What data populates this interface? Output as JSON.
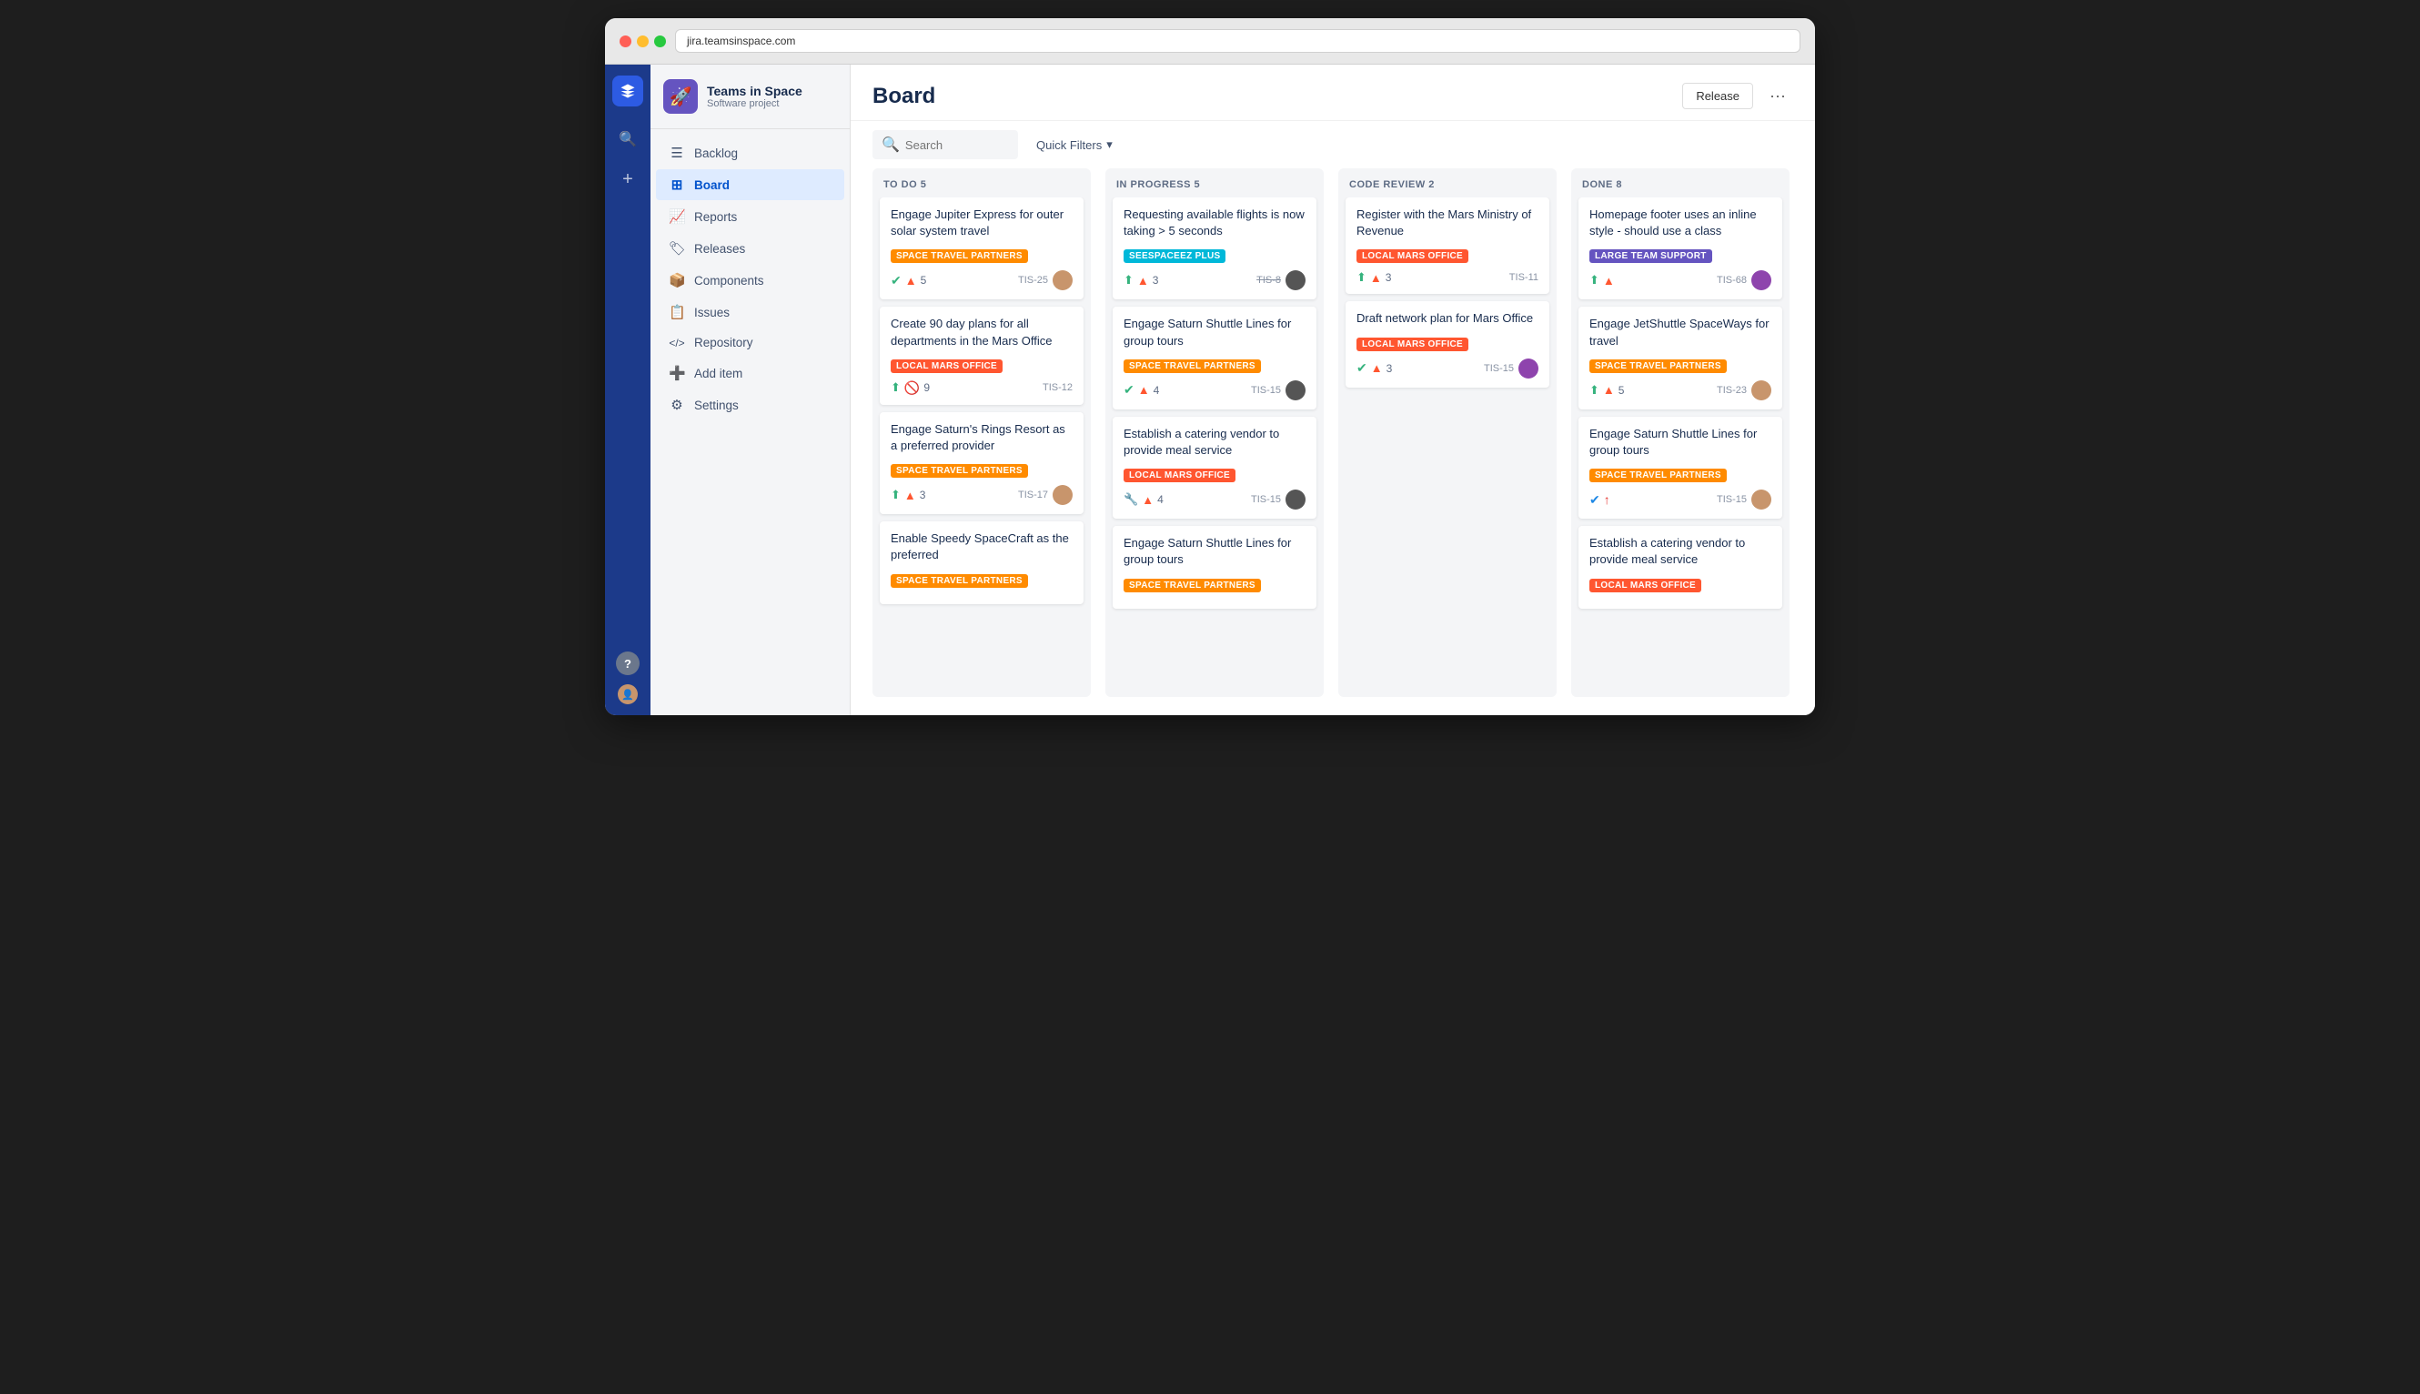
{
  "browser": {
    "url": "jira.teamsinspace.com"
  },
  "app": {
    "project": {
      "name": "Teams in Space",
      "type": "Software project",
      "icon": "🚀"
    },
    "nav": [
      {
        "id": "backlog",
        "label": "Backlog",
        "icon": "☰"
      },
      {
        "id": "board",
        "label": "Board",
        "icon": "⊞",
        "active": true
      },
      {
        "id": "reports",
        "label": "Reports",
        "icon": "📈"
      },
      {
        "id": "releases",
        "label": "Releases",
        "icon": "🏷"
      },
      {
        "id": "components",
        "label": "Components",
        "icon": "📦"
      },
      {
        "id": "issues",
        "label": "Issues",
        "icon": "📋"
      },
      {
        "id": "repository",
        "label": "Repository",
        "icon": "<>"
      },
      {
        "id": "add-item",
        "label": "Add item",
        "icon": "+"
      },
      {
        "id": "settings",
        "label": "Settings",
        "icon": "⚙"
      }
    ],
    "header": {
      "title": "Board",
      "release_button": "Release",
      "more_button": "···"
    },
    "filters": {
      "search_placeholder": "Search",
      "quick_filters_label": "Quick Filters",
      "quick_filters_icon": "▾"
    },
    "columns": [
      {
        "id": "todo",
        "title": "TO DO",
        "count": 5,
        "cards": [
          {
            "id": "c1",
            "title": "Engage Jupiter Express for outer solar system travel",
            "label": "SPACE TRAVEL PARTNERS",
            "label_type": "space-travel",
            "icons": [
              "check",
              "priority"
            ],
            "count": 5,
            "ticket_id": "TIS-25",
            "ticket_crossed": false,
            "avatar_color": "brown"
          },
          {
            "id": "c2",
            "title": "Create 90 day plans for all departments in the Mars Office",
            "label": "LOCAL MARS OFFICE",
            "label_type": "local-mars",
            "icons": [
              "story",
              "blocked"
            ],
            "count": 9,
            "ticket_id": "TIS-12",
            "ticket_crossed": false,
            "avatar_color": ""
          },
          {
            "id": "c3",
            "title": "Engage Saturn's Rings Resort as a preferred provider",
            "label": "SPACE TRAVEL PARTNERS",
            "label_type": "space-travel",
            "icons": [
              "story",
              "priority"
            ],
            "count": 3,
            "ticket_id": "TIS-17",
            "ticket_crossed": false,
            "avatar_color": "brown"
          },
          {
            "id": "c4",
            "title": "Enable Speedy SpaceCraft as the preferred",
            "label": "SPACE TRAVEL PARTNERS",
            "label_type": "space-travel",
            "icons": [],
            "count": 0,
            "ticket_id": "",
            "ticket_crossed": false,
            "avatar_color": ""
          }
        ]
      },
      {
        "id": "inprogress",
        "title": "IN PROGRESS",
        "count": 5,
        "cards": [
          {
            "id": "c5",
            "title": "Requesting available flights is now taking > 5 seconds",
            "label": "SEESPACEEZ PLUS",
            "label_type": "seespaceez",
            "icons": [
              "story",
              "priority"
            ],
            "count": 3,
            "ticket_id": "TIS-8",
            "ticket_crossed": true,
            "avatar_color": "dark"
          },
          {
            "id": "c6",
            "title": "Engage Saturn Shuttle Lines for group tours",
            "label": "SPACE TRAVEL PARTNERS",
            "label_type": "space-travel",
            "icons": [
              "check",
              "priority"
            ],
            "count": 4,
            "ticket_id": "TIS-15",
            "ticket_crossed": false,
            "avatar_color": "dark"
          },
          {
            "id": "c7",
            "title": "Establish a catering vendor to provide meal service",
            "label": "LOCAL MARS OFFICE",
            "label_type": "local-mars",
            "icons": [
              "wrench",
              "priority"
            ],
            "count": 4,
            "ticket_id": "TIS-15",
            "ticket_crossed": false,
            "avatar_color": "dark"
          },
          {
            "id": "c8",
            "title": "Engage Saturn Shuttle Lines for group tours",
            "label": "SPACE TRAVEL PARTNERS",
            "label_type": "space-travel",
            "icons": [],
            "count": 0,
            "ticket_id": "",
            "ticket_crossed": false,
            "avatar_color": ""
          }
        ]
      },
      {
        "id": "codereview",
        "title": "CODE REVIEW",
        "count": 2,
        "cards": [
          {
            "id": "c9",
            "title": "Register with the Mars Ministry of Revenue",
            "label": "LOCAL MARS OFFICE",
            "label_type": "local-mars",
            "icons": [
              "story",
              "priority"
            ],
            "count": 3,
            "ticket_id": "TIS-11",
            "ticket_crossed": false,
            "avatar_color": ""
          },
          {
            "id": "c10",
            "title": "Draft network plan for Mars Office",
            "label": "LOCAL MARS OFFICE",
            "label_type": "local-mars",
            "icons": [
              "check",
              "priority"
            ],
            "count": 3,
            "ticket_id": "TIS-15",
            "ticket_crossed": false,
            "avatar_color": "purple"
          }
        ]
      },
      {
        "id": "done",
        "title": "DONE",
        "count": 8,
        "cards": [
          {
            "id": "c11",
            "title": "Homepage footer uses an inline style - should use a class",
            "label": "LARGE TEAM SUPPORT",
            "label_type": "large-team",
            "icons": [
              "story",
              "priority"
            ],
            "count": 0,
            "ticket_id": "TIS-68",
            "ticket_crossed": false,
            "avatar_color": "purple"
          },
          {
            "id": "c12",
            "title": "Engage JetShuttle SpaceWays for travel",
            "label": "SPACE TRAVEL PARTNERS",
            "label_type": "space-travel",
            "icons": [
              "story",
              "priority"
            ],
            "count": 5,
            "ticket_id": "TIS-23",
            "ticket_crossed": false,
            "avatar_color": "brown"
          },
          {
            "id": "c13",
            "title": "Engage Saturn Shuttle Lines for group tours",
            "label": "SPACE TRAVEL PARTNERS",
            "label_type": "space-travel",
            "icons": [
              "check",
              "priority-red"
            ],
            "count": 0,
            "ticket_id": "TIS-15",
            "ticket_crossed": false,
            "avatar_color": "brown"
          },
          {
            "id": "c14",
            "title": "Establish a catering vendor to provide meal service",
            "label": "LOCAL MARS OFFICE",
            "label_type": "local-mars",
            "icons": [],
            "count": 0,
            "ticket_id": "",
            "ticket_crossed": false,
            "avatar_color": ""
          }
        ]
      }
    ]
  }
}
